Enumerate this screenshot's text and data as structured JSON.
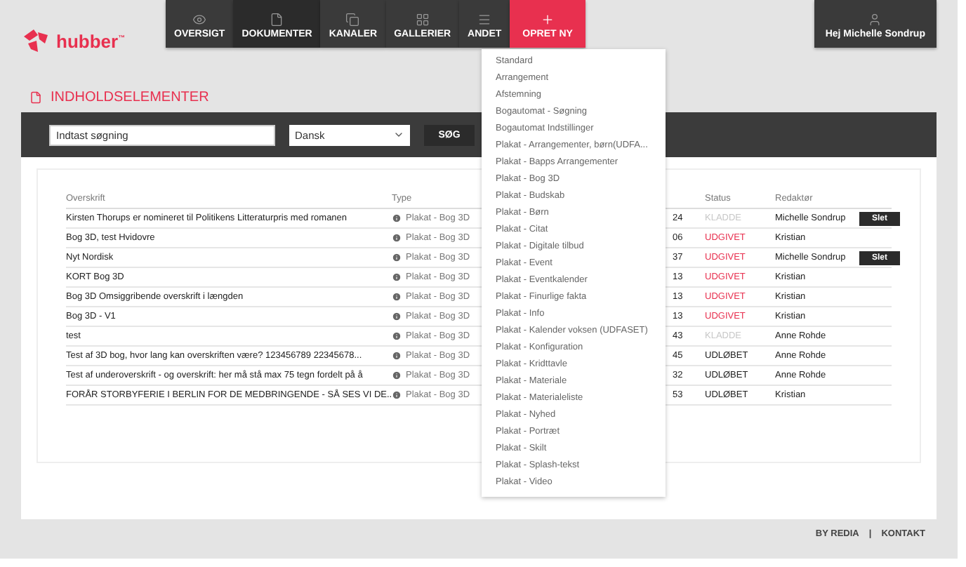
{
  "logo": {
    "text": "hubber$^{™}$"
  },
  "nav": [
    {
      "label": "OVERSIGT",
      "selected": false
    },
    {
      "label": "DOKUMENTER",
      "selected": true
    },
    {
      "label": "KANALER",
      "selected": false
    },
    {
      "label": "GALLERIER",
      "selected": false
    },
    {
      "label": "ANDET",
      "selected": false
    }
  ],
  "create_button": {
    "label": "OPRET NY",
    "expanded": true
  },
  "user_button": {
    "label": "Hej Michelle Sondrup"
  },
  "page_title": "INDHOLDSELEMENTER",
  "search": {
    "placeholder": "Indtast søgning",
    "language": "Dansk",
    "button": "SØG"
  },
  "table": {
    "columns": [
      "Overskrift",
      "Type",
      "Status",
      "Redaktør"
    ],
    "rows": [
      {
        "title": "Kirsten Thorups er nomineret til Politikens Litteraturpris med romanen",
        "type": "Plakat - Bog 3D",
        "column_4": "24",
        "status": "KLADDE",
        "color": "#c8c8c8",
        "editor": "Michelle Sondrup",
        "action": "Slet"
      },
      {
        "title": "Bog 3D, test Hvidovre",
        "type": "Plakat - Bog 3D",
        "column_4": "06",
        "status": "UDGIVET",
        "color": "#e8304f",
        "editor": "Kristian"
      },
      {
        "title": "Nyt Nordisk",
        "type": "Plakat - Bog 3D",
        "column_4": "37",
        "status": "UDGIVET",
        "color": "#e8304f",
        "editor": "Michelle Sondrup",
        "action": "Slet"
      },
      {
        "title": "KORT Bog 3D",
        "type": "Plakat - Bog 3D",
        "column_4": "13",
        "status": "UDGIVET",
        "color": "#e8304f",
        "editor": "Kristian"
      },
      {
        "title": "Bog 3D Omsiggribende overskrift i længden",
        "type": "Plakat - Bog 3D",
        "column_4": "13",
        "status": "UDGIVET",
        "color": "#e8304f",
        "editor": "Kristian"
      },
      {
        "title": "Bog 3D - V1",
        "type": "Plakat - Bog 3D",
        "column_4": "13",
        "status": "UDGIVET",
        "color": "#e8304f",
        "editor": "Kristian"
      },
      {
        "title": "test",
        "type": "Plakat - Bog 3D",
        "column_4": "43",
        "status": "KLADDE",
        "color": "#c8c8c8",
        "editor": "Anne Rohde"
      },
      {
        "title": "Test af 3D bog, hvor lang kan overskriften være? 123456789 22345678...",
        "type": "Plakat - Bog 3D",
        "column_4": "45",
        "status": "UDLØBET",
        "color": "#222222",
        "editor": "Anne Rohde"
      },
      {
        "title": "Test af underoverskrift - og overskrift: her må stå max 75 tegn fordelt på å",
        "type": "Plakat - Bog 3D",
        "column_4": "32",
        "status": "UDLØBET",
        "color": "#222222",
        "editor": "Anne Rohde"
      },
      {
        "title": "FORÅR STORBYFERIE I BERLIN FOR DE MEDBRINGENDE - SÅ SES VI DE...",
        "type": "Plakat - Bog 3D",
        "column_4": "53",
        "status": "UDLØBET",
        "color": "#222222",
        "editor": "Kristian"
      }
    ]
  },
  "create_menu": [
    "Standard",
    "Arrangement",
    "Afstemning",
    "Bogautomat - Søgning",
    "Bogautomat Indstillinger",
    "Plakat - Arrangementer, børn(UDFA...",
    "Plakat - Bapps Arrangementer",
    "Plakat - Bog 3D",
    "Plakat - Budskab",
    "Plakat - Børn",
    "Plakat - Citat",
    "Plakat - Digitale tilbud",
    "Plakat - Event",
    "Plakat - Eventkalender",
    "Plakat - Finurlige fakta",
    "Plakat - Info",
    "Plakat - Kalender voksen (UDFASET)",
    "Plakat - Konfiguration",
    "Plakat - Kridttavle",
    "Plakat - Materiale",
    "Plakat - Materialeliste",
    "Plakat - Nyhed",
    "Plakat - Portræt",
    "Plakat - Skilt",
    "Plakat - Splash-tekst",
    "Plakat - Video"
  ],
  "footer": {
    "links": [
      "BY REDIA",
      "KONTAKT"
    ],
    "separator": "|"
  }
}
